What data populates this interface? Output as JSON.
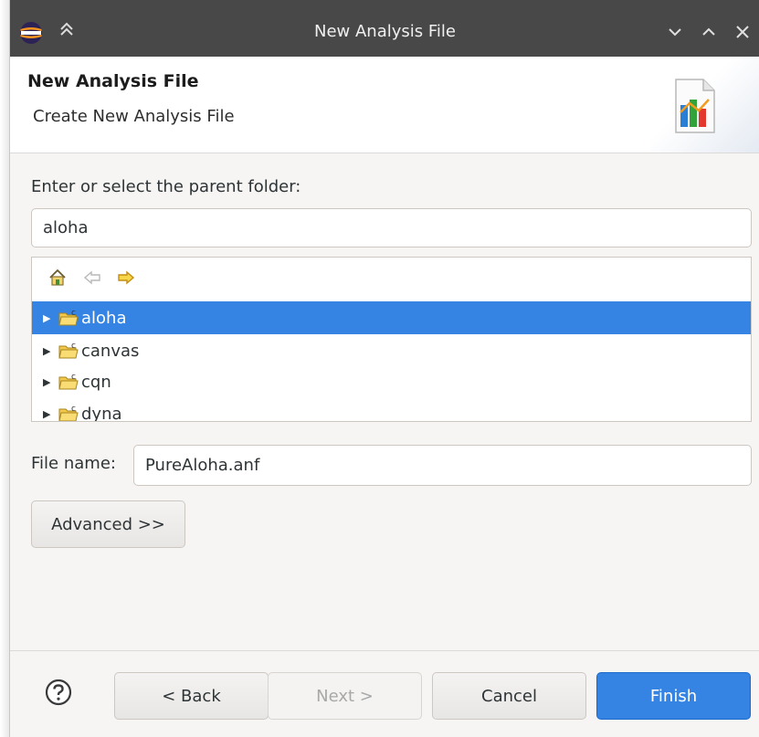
{
  "window": {
    "title": "New Analysis File",
    "icons": [
      "eclipse-app-icon",
      "keep-above-icon",
      "minimize-icon",
      "maximize-icon",
      "close-icon"
    ]
  },
  "banner": {
    "heading": "New Analysis File",
    "description": "Create New Analysis File",
    "icon": "analysis-wizard-icon"
  },
  "folder_section": {
    "label": "Enter or select the parent folder:",
    "folder_value": "aloha",
    "toolbar": [
      "home-icon",
      "back-arrow-icon",
      "forward-arrow-icon"
    ],
    "tree_items": [
      {
        "label": "aloha",
        "selected": true
      },
      {
        "label": "canvas",
        "selected": false
      },
      {
        "label": "cqn",
        "selected": false
      },
      {
        "label": "dyna",
        "selected": false
      }
    ]
  },
  "file_name": {
    "label": "File name:",
    "value": "PureAloha.anf"
  },
  "advanced_button": "Advanced >>",
  "footer": {
    "help_icon": "help-icon",
    "back": "< Back",
    "next": "Next >",
    "cancel": "Cancel",
    "finish": "Finish"
  },
  "colors": {
    "accent": "#3584e4",
    "titlebar": "#484848"
  }
}
